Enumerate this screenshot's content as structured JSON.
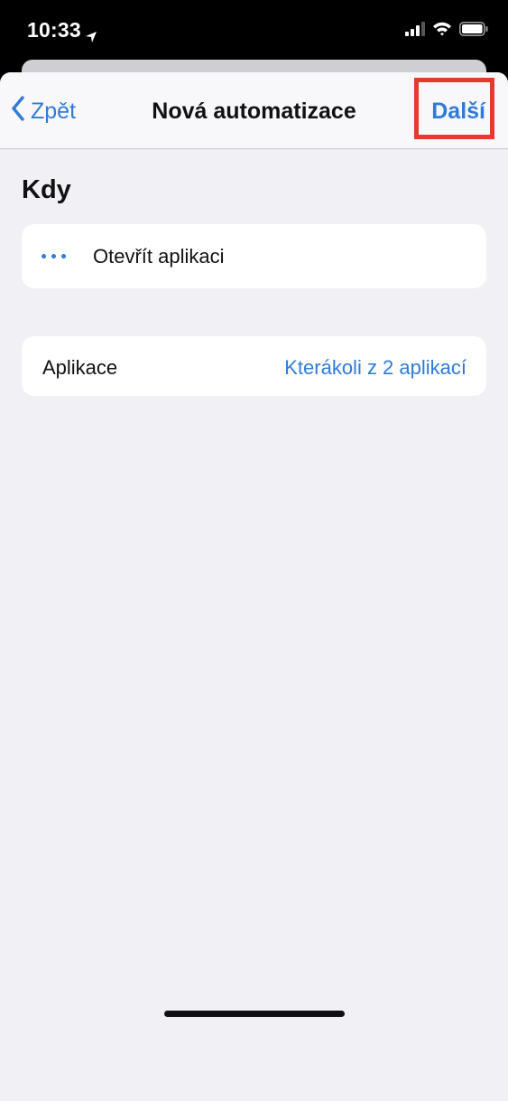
{
  "status_bar": {
    "time": "10:33",
    "icons": [
      "location-arrow-icon",
      "cellular-signal-icon",
      "wifi-icon",
      "battery-icon"
    ]
  },
  "nav": {
    "back_label": "Zpět",
    "title": "Nová automatizace",
    "next_label": "Další"
  },
  "section": {
    "title": "Kdy"
  },
  "trigger": {
    "label": "Otevřít aplikaci"
  },
  "app_row": {
    "label": "Aplikace",
    "value": "Kterákoli z 2 aplikací"
  },
  "colors": {
    "accent": "#2f7bd9",
    "highlight": "#e63b2c",
    "background": "#f1f0f5"
  }
}
